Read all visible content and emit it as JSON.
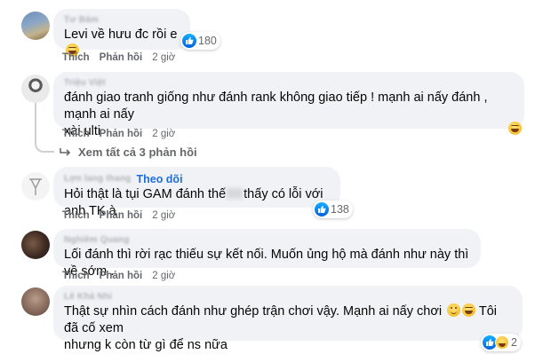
{
  "comments": [
    {
      "author": "Tư Bám",
      "text": "Levi về hưu đc rồi e",
      "reaction_count": "180",
      "actions": {
        "like": "Thích",
        "reply": "Phản hồi",
        "time": "2 giờ"
      }
    },
    {
      "author": "Triệu Việt",
      "text_line1": "đánh giao tranh giống như đánh rank không giao tiếp ! mạnh ai nấy đánh , mạnh ai nấy",
      "text_line2": "xài ulti",
      "actions": {
        "like": "Thích",
        "reply": "Phản hồi",
        "time": "2 giờ"
      },
      "view_more": "Xem tất cả 3 phản hồi"
    },
    {
      "author": "Lợn lang thang",
      "follow": "Theo dõi",
      "text_before": "Hỏi thật là tụi GAM đánh thế",
      "text_after": "thấy có lỗi với anh TK à",
      "reaction_count": "138",
      "actions": {
        "like": "Thích",
        "reply": "Phản hồi",
        "time": "2 giờ"
      }
    },
    {
      "author": "Nghiêm Quang",
      "text": "Lối đánh thì rời rạc thiếu sự kết nối. Muốn ủng hộ mà đánh như này thì về sớm .",
      "actions": {
        "like": "Thích",
        "reply": "Phản hồi",
        "time": "2 giờ"
      }
    },
    {
      "author": "Lê Khả Nhi",
      "text_line1": "Thật sự nhìn cách đánh như ghép trận chơi vậy. Mạnh ai nấy chơi",
      "text_line1_after": "Tôi đã cố xem",
      "text_line2": "nhưng k còn từ gì để ns nữa",
      "reaction_count": "2"
    }
  ],
  "icons": {
    "like": "thumbs-up-icon",
    "haha": "laughing-face-icon",
    "smile": "smiling-face-icon",
    "reply": "reply-arrow-icon"
  },
  "colors": {
    "bubble": "#f0f2f5",
    "like_blue": "#0866ff",
    "follow_link": "#216fdb",
    "secondary_text": "#65676b"
  }
}
